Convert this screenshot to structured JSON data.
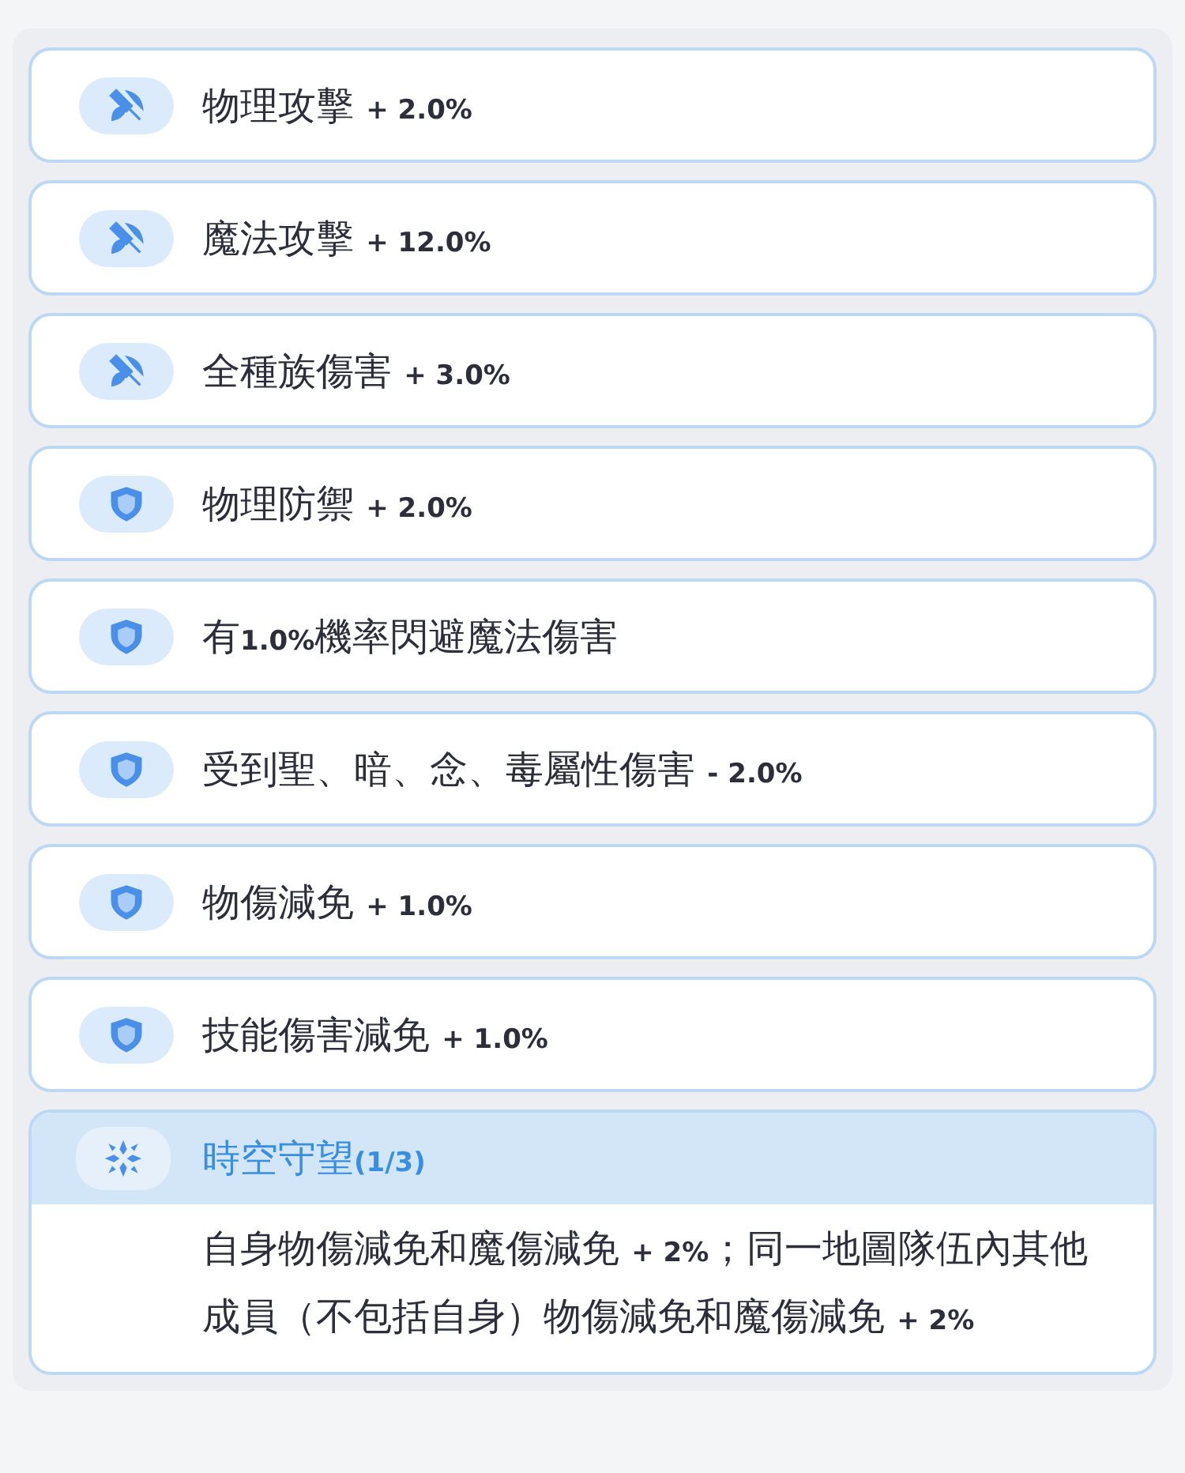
{
  "effects": [
    {
      "kind": "attack",
      "text": "物理攻擊 **+ 2.0%**"
    },
    {
      "kind": "attack",
      "text": "魔法攻擊 **+ 12.0%**"
    },
    {
      "kind": "attack",
      "text": "全種族傷害 **+ 3.0%**"
    },
    {
      "kind": "defense",
      "text": "物理防禦 **+ 2.0%**"
    },
    {
      "kind": "defense",
      "text": "有**1.0%**機率閃避魔法傷害"
    },
    {
      "kind": "defense",
      "text": "受到聖、暗、念、毒屬性傷害 **- 2.0%**"
    },
    {
      "kind": "defense",
      "text": "物傷減免 **+ 1.0%**"
    },
    {
      "kind": "defense",
      "text": "技能傷害減免 **+ 1.0%**"
    }
  ],
  "set_bonus": {
    "kind": "set",
    "title": "時空守望**(1/3)**",
    "description": "自身物傷減免和魔傷減免 **+ 2%**；同一地圖隊伍內其他成員（不包括自身）物傷減免和魔傷減免 **+ 2%**"
  }
}
